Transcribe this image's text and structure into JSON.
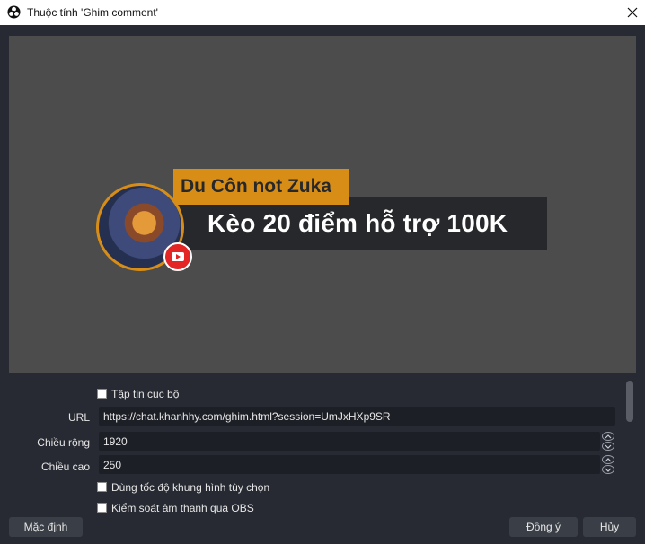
{
  "window": {
    "title": "Thuộc tính 'Ghim comment'",
    "icon": "obs-icon",
    "close_icon": "close-icon"
  },
  "preview": {
    "author": "Du Côn not Zuka",
    "message": "Kèo 20 điểm hỗ trợ 100K",
    "accent_color": "#d88e16",
    "bar_color": "#26282b",
    "badge_icon": "youtube-icon"
  },
  "form": {
    "local_file_label": "Tập tin cục bộ",
    "local_file_checked": false,
    "url_label": "URL",
    "url_value": "https://chat.khanhhy.com/ghim.html?session=UmJxHXp9SR",
    "width_label": "Chiều rộng",
    "width_value": "1920",
    "height_label": "Chiều cao",
    "height_value": "250",
    "custom_fps_label": "Dùng tốc độ khung hình tùy chọn",
    "custom_fps_checked": false,
    "obs_audio_label": "Kiểm soát âm thanh qua OBS",
    "obs_audio_checked": false
  },
  "buttons": {
    "defaults": "Mặc định",
    "ok": "Đồng ý",
    "cancel": "Hủy"
  }
}
